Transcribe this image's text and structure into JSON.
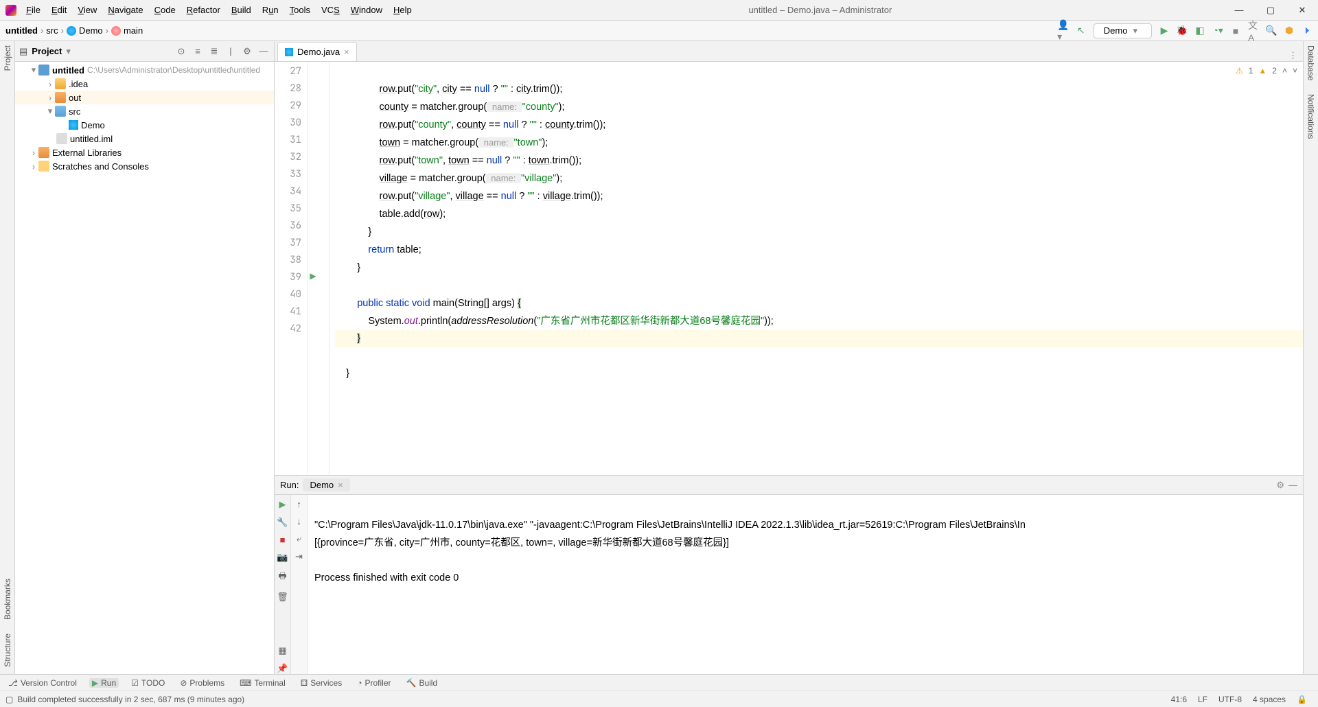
{
  "window": {
    "title": "untitled – Demo.java – Administrator"
  },
  "menus": [
    "File",
    "Edit",
    "View",
    "Navigate",
    "Code",
    "Refactor",
    "Build",
    "Run",
    "Tools",
    "VCS",
    "Window",
    "Help"
  ],
  "breadcrumb": {
    "project": "untitled",
    "src": "src",
    "class": "Demo",
    "method": "main"
  },
  "runconfig": {
    "label": "Demo"
  },
  "project_panel": {
    "title": "Project",
    "root": {
      "name": "untitled",
      "path": "C:\\Users\\Administrator\\Desktop\\untitled\\untitled"
    },
    "idea": ".idea",
    "out": "out",
    "src": "src",
    "demo": "Demo",
    "iml": "untitled.iml",
    "ext": "External Libraries",
    "scratch": "Scratches and Consoles"
  },
  "editor": {
    "tab": "Demo.java",
    "warn1": "1",
    "warn2": "2",
    "lines_start": 27,
    "lines_end": 42,
    "code": {
      "l27": {
        "a": "row",
        "b": ".put(",
        "c": "\"city\"",
        "d": ", ",
        "e": "city",
        "f": " == ",
        "g": "null",
        "h": " ? ",
        "i": "\"\"",
        "j": " : ",
        "k": "city",
        "l": ".trim());"
      },
      "l28": {
        "a": "county",
        "b": " = matcher.group(",
        "hint": " name: ",
        "c": "\"county\"",
        "d": ");"
      },
      "l29": {
        "a": "row",
        "b": ".put(",
        "c": "\"county\"",
        "d": ", ",
        "e": "county",
        "f": " == ",
        "g": "null",
        "h": " ? ",
        "i": "\"\"",
        "j": " : ",
        "k": "county",
        "l": ".trim());"
      },
      "l30": {
        "a": "town",
        "b": " = matcher.group(",
        "hint": " name: ",
        "c": "\"town\"",
        "d": ");"
      },
      "l31": {
        "a": "row",
        "b": ".put(",
        "c": "\"town\"",
        "d": ", ",
        "e": "town",
        "f": " == ",
        "g": "null",
        "h": " ? ",
        "i": "\"\"",
        "j": " : ",
        "k": "town",
        "l": ".trim());"
      },
      "l32": {
        "a": "village",
        "b": " = matcher.group(",
        "hint": " name: ",
        "c": "\"village\"",
        "d": ");"
      },
      "l33": {
        "a": "row",
        "b": ".put(",
        "c": "\"village\"",
        "d": ", ",
        "e": "village",
        "f": " == ",
        "g": "null",
        "h": " ? ",
        "i": "\"\"",
        "j": " : ",
        "k": "village",
        "l": ".trim());"
      },
      "l34": {
        "a": "table.add(",
        "b": "row",
        "c": ");"
      },
      "l35": "            }",
      "l36": {
        "a": "return",
        "b": " table;"
      },
      "l37": "        }",
      "l38": "",
      "l39": {
        "a": "public",
        "b": "static",
        "c": "void",
        "d": "main",
        "e": "(String[] args) ",
        "f": "{"
      },
      "l40": {
        "a": "System.",
        "b": "out",
        "c": ".println(",
        "d": "addressResolution",
        "e": "(",
        "f": "\"广东省广州市花都区新华街新都大道68号馨庭花园\"",
        "g": "));"
      },
      "l41": {
        "a": "}"
      },
      "l42": "    }"
    }
  },
  "run_panel": {
    "label": "Run:",
    "tab": "Demo",
    "line1": "\"C:\\Program Files\\Java\\jdk-11.0.17\\bin\\java.exe\" \"-javaagent:C:\\Program Files\\JetBrains\\IntelliJ IDEA 2022.1.3\\lib\\idea_rt.jar=52619:C:\\Program Files\\JetBrains\\In",
    "line2": "[{province=广东省, city=广州市, county=花都区, town=, village=新华街新都大道68号馨庭花园}]",
    "line3": "Process finished with exit code 0"
  },
  "bottom_tabs": {
    "vc": "Version Control",
    "run": "Run",
    "todo": "TODO",
    "problems": "Problems",
    "terminal": "Terminal",
    "services": "Services",
    "profiler": "Profiler",
    "build": "Build"
  },
  "sidebars": {
    "project": "Project",
    "bookmarks": "Bookmarks",
    "structure": "Structure",
    "database": "Database",
    "notifications": "Notifications"
  },
  "status": {
    "msg": "Build completed successfully in 2 sec, 687 ms (9 minutes ago)",
    "pos": "41:6",
    "lf": "LF",
    "enc": "UTF-8",
    "indent": "4 spaces"
  }
}
